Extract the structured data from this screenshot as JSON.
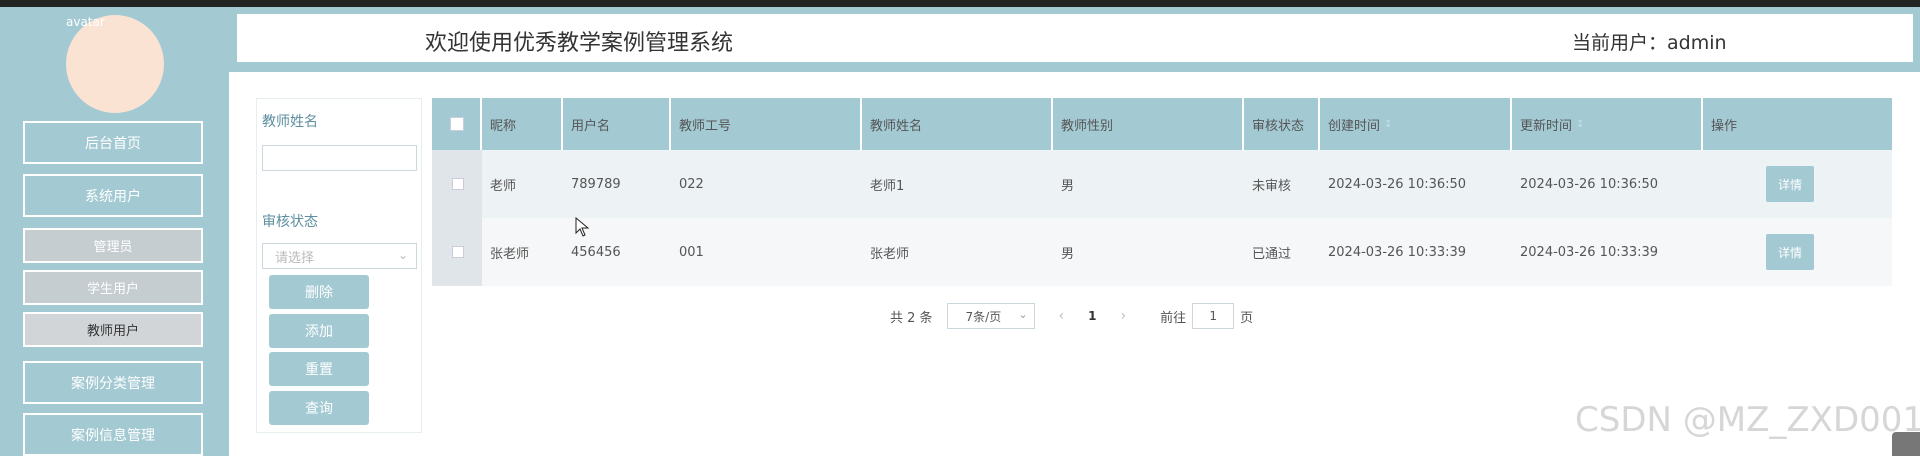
{
  "sidebar": {
    "avatar_alt": "avatar",
    "items": [
      {
        "label": "后台首页"
      },
      {
        "label": "系统用户"
      },
      {
        "label": "管理员"
      },
      {
        "label": "学生用户"
      },
      {
        "label": "教师用户"
      },
      {
        "label": "案例分类管理"
      },
      {
        "label": "案例信息管理"
      }
    ]
  },
  "header": {
    "title": "欢迎使用优秀教学案例管理系统",
    "current_user": "当前用户：admin"
  },
  "search": {
    "teacher_name_label": "教师姓名",
    "teacher_name_value": "",
    "audit_status_label": "审核状态",
    "audit_status_placeholder": "请选择",
    "buttons": {
      "delete": "删除",
      "add": "添加",
      "reset": "重置",
      "query": "查询"
    }
  },
  "table": {
    "columns": [
      "昵称",
      "用户名",
      "教师工号",
      "教师姓名",
      "教师性别",
      "审核状态",
      "创建时间",
      "更新时间",
      "操作"
    ],
    "rows": [
      {
        "nickname": "老师",
        "username": "789789",
        "teacher_no": "022",
        "teacher_name": "老师1",
        "gender": "男",
        "audit_status": "未审核",
        "created": "2024-03-26 10:36:50",
        "updated": "2024-03-26 10:36:50",
        "action": "详情"
      },
      {
        "nickname": "张老师",
        "username": "456456",
        "teacher_no": "001",
        "teacher_name": "张老师",
        "gender": "男",
        "audit_status": "已通过",
        "created": "2024-03-26 10:33:39",
        "updated": "2024-03-26 10:33:39",
        "action": "详情"
      }
    ]
  },
  "pagination": {
    "total": "共 2 条",
    "page_size": "7条/页",
    "current_page": "1",
    "goto_label": "前往",
    "goto_value": "1",
    "page_suffix": "页"
  },
  "watermark": "CSDN @MZ_ZXD001",
  "colors": {
    "accent": "#a3c9d3",
    "avatar": "#fbe3d4"
  }
}
